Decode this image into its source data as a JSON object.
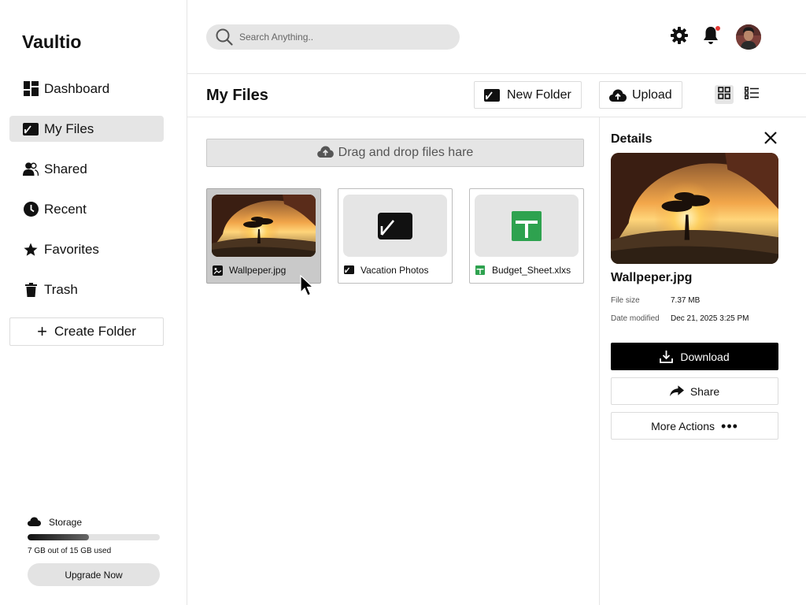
{
  "app": {
    "brand": "Vaultio"
  },
  "sidebar": {
    "items": [
      {
        "label": "Dashboard",
        "icon": "dashboard-icon",
        "active": false
      },
      {
        "label": "My Files",
        "icon": "folder-icon",
        "active": true
      },
      {
        "label": "Shared",
        "icon": "users-icon",
        "active": false
      },
      {
        "label": "Recent",
        "icon": "clock-icon",
        "active": false
      },
      {
        "label": "Favorites",
        "icon": "star-icon",
        "active": false
      },
      {
        "label": "Trash",
        "icon": "trash-icon",
        "active": false
      }
    ],
    "create_folder_label": "Create Folder",
    "storage": {
      "label": "Storage",
      "used_fraction": 0.4667,
      "usage_text": "7 GB out of 15 GB used",
      "upgrade_label": "Upgrade Now"
    }
  },
  "topbar": {
    "search_placeholder": "Search Anything..",
    "notification_dot_color": "#e53935"
  },
  "toolbar": {
    "title": "My Files",
    "new_folder_label": "New Folder",
    "upload_label": "Upload",
    "view_mode": "grid"
  },
  "main": {
    "dropzone_label": "Drag and drop files hare",
    "files": [
      {
        "name": "Wallpeper.jpg",
        "type": "image",
        "icon": "image-icon",
        "selected": true
      },
      {
        "name": "Vacation Photos",
        "type": "folder",
        "icon": "folder-icon",
        "selected": false
      },
      {
        "name": "Budget_Sheet.xlxs",
        "type": "spreadsheet",
        "icon": "spreadsheet-icon",
        "selected": false
      }
    ]
  },
  "details": {
    "title": "Details",
    "file_name": "Wallpeper.jpg",
    "file_size_label": "File size",
    "file_size": "7.37 MB",
    "date_modified_label": "Date modified",
    "date_modified": "Dec 21, 2025 3:25 PM",
    "download_label": "Download",
    "share_label": "Share",
    "more_actions_label": "More Actions"
  },
  "colors": {
    "accent": "#000000",
    "sidebar_active": "#e5e5e5",
    "spreadsheet_green": "#2ea24f"
  }
}
